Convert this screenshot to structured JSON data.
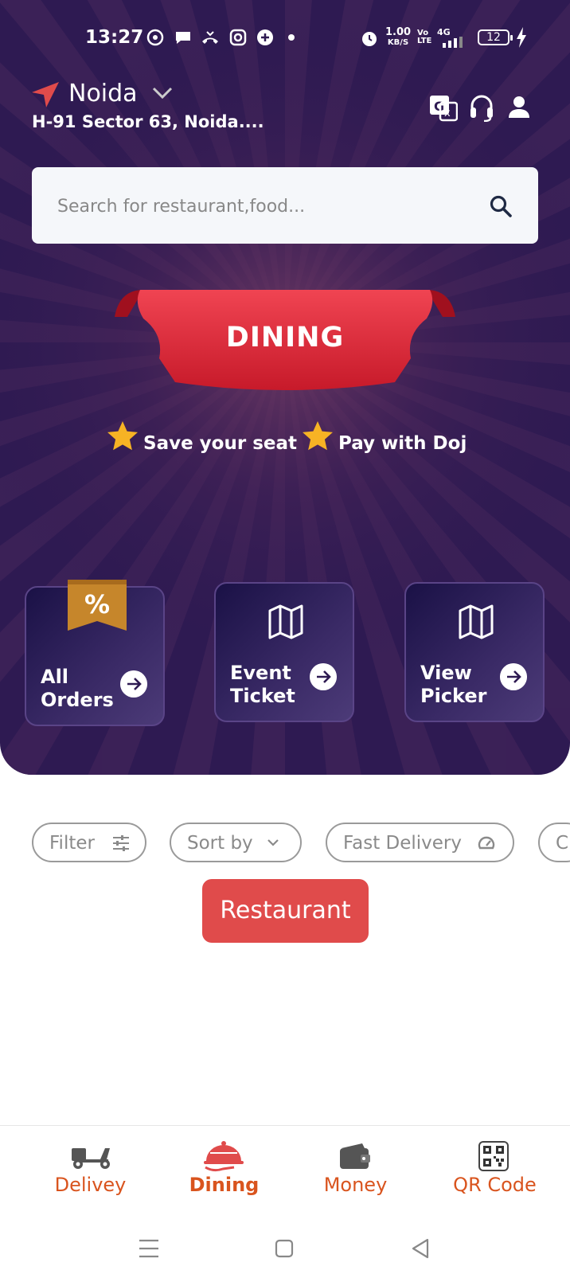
{
  "status_bar": {
    "time": "13:27",
    "net_speed_value": "1.00",
    "net_speed_unit": "KB/S",
    "volte": "Vo LTE",
    "network": "4G",
    "battery": "12"
  },
  "header": {
    "city": "Noida",
    "address": "H-91 Sector 63, Noida....",
    "icons": [
      "translate-icon",
      "headset-icon",
      "profile-icon"
    ]
  },
  "search": {
    "placeholder": "Search for restaurant,food..."
  },
  "banner": {
    "title": "DINING",
    "features": [
      "Save your seat",
      "Pay with Doj"
    ]
  },
  "cards": [
    {
      "label": "All Orders",
      "icon": "discount-badge-icon",
      "badge": "%"
    },
    {
      "label": "Event Ticket",
      "icon": "map-icon"
    },
    {
      "label": "View Picker",
      "icon": "map-icon"
    }
  ],
  "filters": {
    "filter_label": "Filter",
    "sort_label": "Sort by",
    "fast_delivery_label": "Fast Delivery",
    "partial_label": "C"
  },
  "restaurant_button": "Restaurant",
  "bottom_nav": [
    {
      "label": "Delivey",
      "icon": "scooter-icon"
    },
    {
      "label": "Dining",
      "icon": "cloche-icon",
      "active": true
    },
    {
      "label": "Money",
      "icon": "wallet-icon"
    },
    {
      "label": "QR Code",
      "icon": "qr-code-icon"
    }
  ],
  "colors": {
    "hero_bg": "#2e1a52",
    "accent_red": "#e04b4b",
    "nav_orange": "#d9541e",
    "star": "#f7b324"
  }
}
